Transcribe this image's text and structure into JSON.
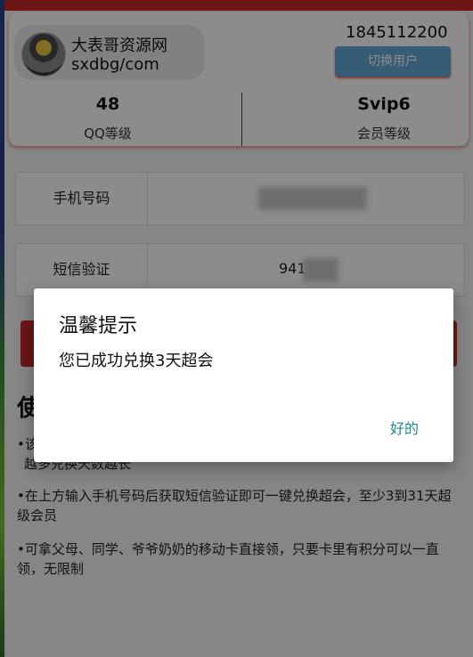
{
  "profile": {
    "site_name": "大表哥资源网",
    "site_url": "sxdbg/com",
    "phone": "1845112200",
    "switch_user_label": "切换用户",
    "qq_level_value": "48",
    "qq_level_label": "QQ等级",
    "vip_level_value": "Svip6",
    "vip_level_label": "会员等级"
  },
  "form": {
    "phone_label": "手机号码",
    "sms_label": "短信验证",
    "sms_code_visible": "941"
  },
  "instructions": {
    "heading": "使",
    "items": [
      "•该",
      "•在上方输入手机号码后获取短信验证即可一键兑换超会，至少3到31天超级会员",
      "•可拿父母、同学、爷爷奶奶的移动卡直接领，只要卡里有积分可以一直领，无限制"
    ],
    "partial_line": "越多兑换天数越长"
  },
  "dialog": {
    "title": "温馨提示",
    "message": "您已成功兑换3天超会",
    "ok_label": "好的"
  },
  "colors": {
    "brand_red": "#c62828",
    "switch_button": "#64a8d6",
    "dialog_action": "#1e8a8a"
  },
  "icons": {
    "avatar": "user-avatar-photo"
  }
}
